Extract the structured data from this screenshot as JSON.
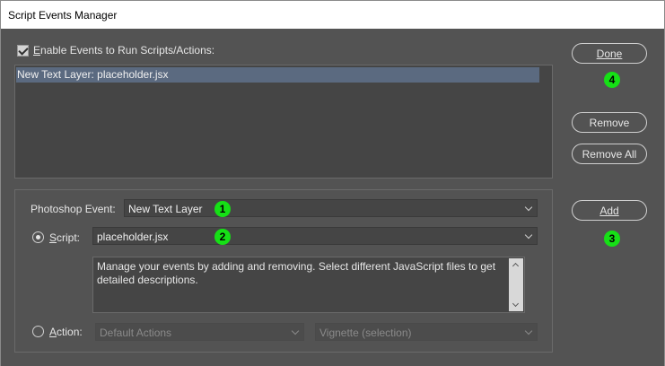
{
  "window": {
    "title": "Script Events Manager"
  },
  "enable": {
    "label": "Enable Events to Run Scripts/Actions:",
    "checked": true
  },
  "events_list": [
    "New Text Layer: placeholder.jsx"
  ],
  "form": {
    "photoshop_event_label": "Photoshop Event:",
    "photoshop_event_value": "New Text Layer",
    "script_label": "Script:",
    "script_value": "placeholder.jsx",
    "description": "Manage your events by adding and removing. Select different JavaScript files to get detailed descriptions.",
    "action_label": "Action:",
    "action_set": "Default Actions",
    "action_name": "Vignette (selection)"
  },
  "buttons": {
    "done": "Done",
    "remove": "Remove",
    "remove_all": "Remove All",
    "add": "Add"
  },
  "markers": [
    "1",
    "2",
    "3",
    "4"
  ],
  "colors": {
    "marker": "#16e016",
    "selection": "#5b6a80",
    "panel": "#535353"
  }
}
